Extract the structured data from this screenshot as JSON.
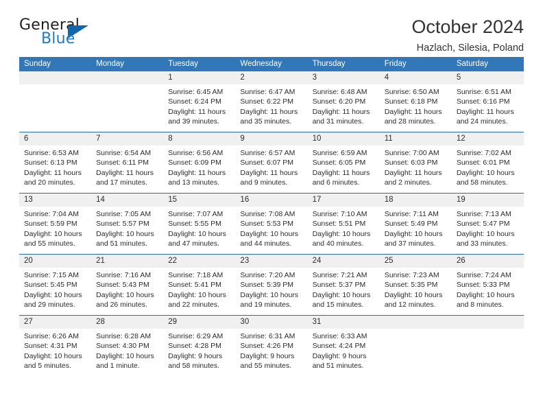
{
  "brand": {
    "name_top": "General",
    "name_bottom": "Blue",
    "triangle_icon": "triangle-icon",
    "color_dark": "#231f20",
    "color_blue": "#1e7bc4"
  },
  "header": {
    "title": "October 2024",
    "subtitle": "Hazlach, Silesia, Poland"
  },
  "theme": {
    "header_blue": "#3277b8",
    "divider_blue": "#2a6aa8",
    "daynum_band": "#f0f0f0",
    "text": "#2b2b2b"
  },
  "calendar": {
    "weekdays": [
      "Sunday",
      "Monday",
      "Tuesday",
      "Wednesday",
      "Thursday",
      "Friday",
      "Saturday"
    ],
    "weeks": [
      [
        {
          "day": "",
          "lines": []
        },
        {
          "day": "",
          "lines": []
        },
        {
          "day": "1",
          "lines": [
            "Sunrise: 6:45 AM",
            "Sunset: 6:24 PM",
            "Daylight: 11 hours",
            "and 39 minutes."
          ]
        },
        {
          "day": "2",
          "lines": [
            "Sunrise: 6:47 AM",
            "Sunset: 6:22 PM",
            "Daylight: 11 hours",
            "and 35 minutes."
          ]
        },
        {
          "day": "3",
          "lines": [
            "Sunrise: 6:48 AM",
            "Sunset: 6:20 PM",
            "Daylight: 11 hours",
            "and 31 minutes."
          ]
        },
        {
          "day": "4",
          "lines": [
            "Sunrise: 6:50 AM",
            "Sunset: 6:18 PM",
            "Daylight: 11 hours",
            "and 28 minutes."
          ]
        },
        {
          "day": "5",
          "lines": [
            "Sunrise: 6:51 AM",
            "Sunset: 6:16 PM",
            "Daylight: 11 hours",
            "and 24 minutes."
          ]
        }
      ],
      [
        {
          "day": "6",
          "lines": [
            "Sunrise: 6:53 AM",
            "Sunset: 6:13 PM",
            "Daylight: 11 hours",
            "and 20 minutes."
          ]
        },
        {
          "day": "7",
          "lines": [
            "Sunrise: 6:54 AM",
            "Sunset: 6:11 PM",
            "Daylight: 11 hours",
            "and 17 minutes."
          ]
        },
        {
          "day": "8",
          "lines": [
            "Sunrise: 6:56 AM",
            "Sunset: 6:09 PM",
            "Daylight: 11 hours",
            "and 13 minutes."
          ]
        },
        {
          "day": "9",
          "lines": [
            "Sunrise: 6:57 AM",
            "Sunset: 6:07 PM",
            "Daylight: 11 hours",
            "and 9 minutes."
          ]
        },
        {
          "day": "10",
          "lines": [
            "Sunrise: 6:59 AM",
            "Sunset: 6:05 PM",
            "Daylight: 11 hours",
            "and 6 minutes."
          ]
        },
        {
          "day": "11",
          "lines": [
            "Sunrise: 7:00 AM",
            "Sunset: 6:03 PM",
            "Daylight: 11 hours",
            "and 2 minutes."
          ]
        },
        {
          "day": "12",
          "lines": [
            "Sunrise: 7:02 AM",
            "Sunset: 6:01 PM",
            "Daylight: 10 hours",
            "and 58 minutes."
          ]
        }
      ],
      [
        {
          "day": "13",
          "lines": [
            "Sunrise: 7:04 AM",
            "Sunset: 5:59 PM",
            "Daylight: 10 hours",
            "and 55 minutes."
          ]
        },
        {
          "day": "14",
          "lines": [
            "Sunrise: 7:05 AM",
            "Sunset: 5:57 PM",
            "Daylight: 10 hours",
            "and 51 minutes."
          ]
        },
        {
          "day": "15",
          "lines": [
            "Sunrise: 7:07 AM",
            "Sunset: 5:55 PM",
            "Daylight: 10 hours",
            "and 47 minutes."
          ]
        },
        {
          "day": "16",
          "lines": [
            "Sunrise: 7:08 AM",
            "Sunset: 5:53 PM",
            "Daylight: 10 hours",
            "and 44 minutes."
          ]
        },
        {
          "day": "17",
          "lines": [
            "Sunrise: 7:10 AM",
            "Sunset: 5:51 PM",
            "Daylight: 10 hours",
            "and 40 minutes."
          ]
        },
        {
          "day": "18",
          "lines": [
            "Sunrise: 7:11 AM",
            "Sunset: 5:49 PM",
            "Daylight: 10 hours",
            "and 37 minutes."
          ]
        },
        {
          "day": "19",
          "lines": [
            "Sunrise: 7:13 AM",
            "Sunset: 5:47 PM",
            "Daylight: 10 hours",
            "and 33 minutes."
          ]
        }
      ],
      [
        {
          "day": "20",
          "lines": [
            "Sunrise: 7:15 AM",
            "Sunset: 5:45 PM",
            "Daylight: 10 hours",
            "and 29 minutes."
          ]
        },
        {
          "day": "21",
          "lines": [
            "Sunrise: 7:16 AM",
            "Sunset: 5:43 PM",
            "Daylight: 10 hours",
            "and 26 minutes."
          ]
        },
        {
          "day": "22",
          "lines": [
            "Sunrise: 7:18 AM",
            "Sunset: 5:41 PM",
            "Daylight: 10 hours",
            "and 22 minutes."
          ]
        },
        {
          "day": "23",
          "lines": [
            "Sunrise: 7:20 AM",
            "Sunset: 5:39 PM",
            "Daylight: 10 hours",
            "and 19 minutes."
          ]
        },
        {
          "day": "24",
          "lines": [
            "Sunrise: 7:21 AM",
            "Sunset: 5:37 PM",
            "Daylight: 10 hours",
            "and 15 minutes."
          ]
        },
        {
          "day": "25",
          "lines": [
            "Sunrise: 7:23 AM",
            "Sunset: 5:35 PM",
            "Daylight: 10 hours",
            "and 12 minutes."
          ]
        },
        {
          "day": "26",
          "lines": [
            "Sunrise: 7:24 AM",
            "Sunset: 5:33 PM",
            "Daylight: 10 hours",
            "and 8 minutes."
          ]
        }
      ],
      [
        {
          "day": "27",
          "lines": [
            "Sunrise: 6:26 AM",
            "Sunset: 4:31 PM",
            "Daylight: 10 hours",
            "and 5 minutes."
          ]
        },
        {
          "day": "28",
          "lines": [
            "Sunrise: 6:28 AM",
            "Sunset: 4:30 PM",
            "Daylight: 10 hours",
            "and 1 minute."
          ]
        },
        {
          "day": "29",
          "lines": [
            "Sunrise: 6:29 AM",
            "Sunset: 4:28 PM",
            "Daylight: 9 hours",
            "and 58 minutes."
          ]
        },
        {
          "day": "30",
          "lines": [
            "Sunrise: 6:31 AM",
            "Sunset: 4:26 PM",
            "Daylight: 9 hours",
            "and 55 minutes."
          ]
        },
        {
          "day": "31",
          "lines": [
            "Sunrise: 6:33 AM",
            "Sunset: 4:24 PM",
            "Daylight: 9 hours",
            "and 51 minutes."
          ]
        },
        {
          "day": "",
          "lines": []
        },
        {
          "day": "",
          "lines": []
        }
      ]
    ]
  }
}
